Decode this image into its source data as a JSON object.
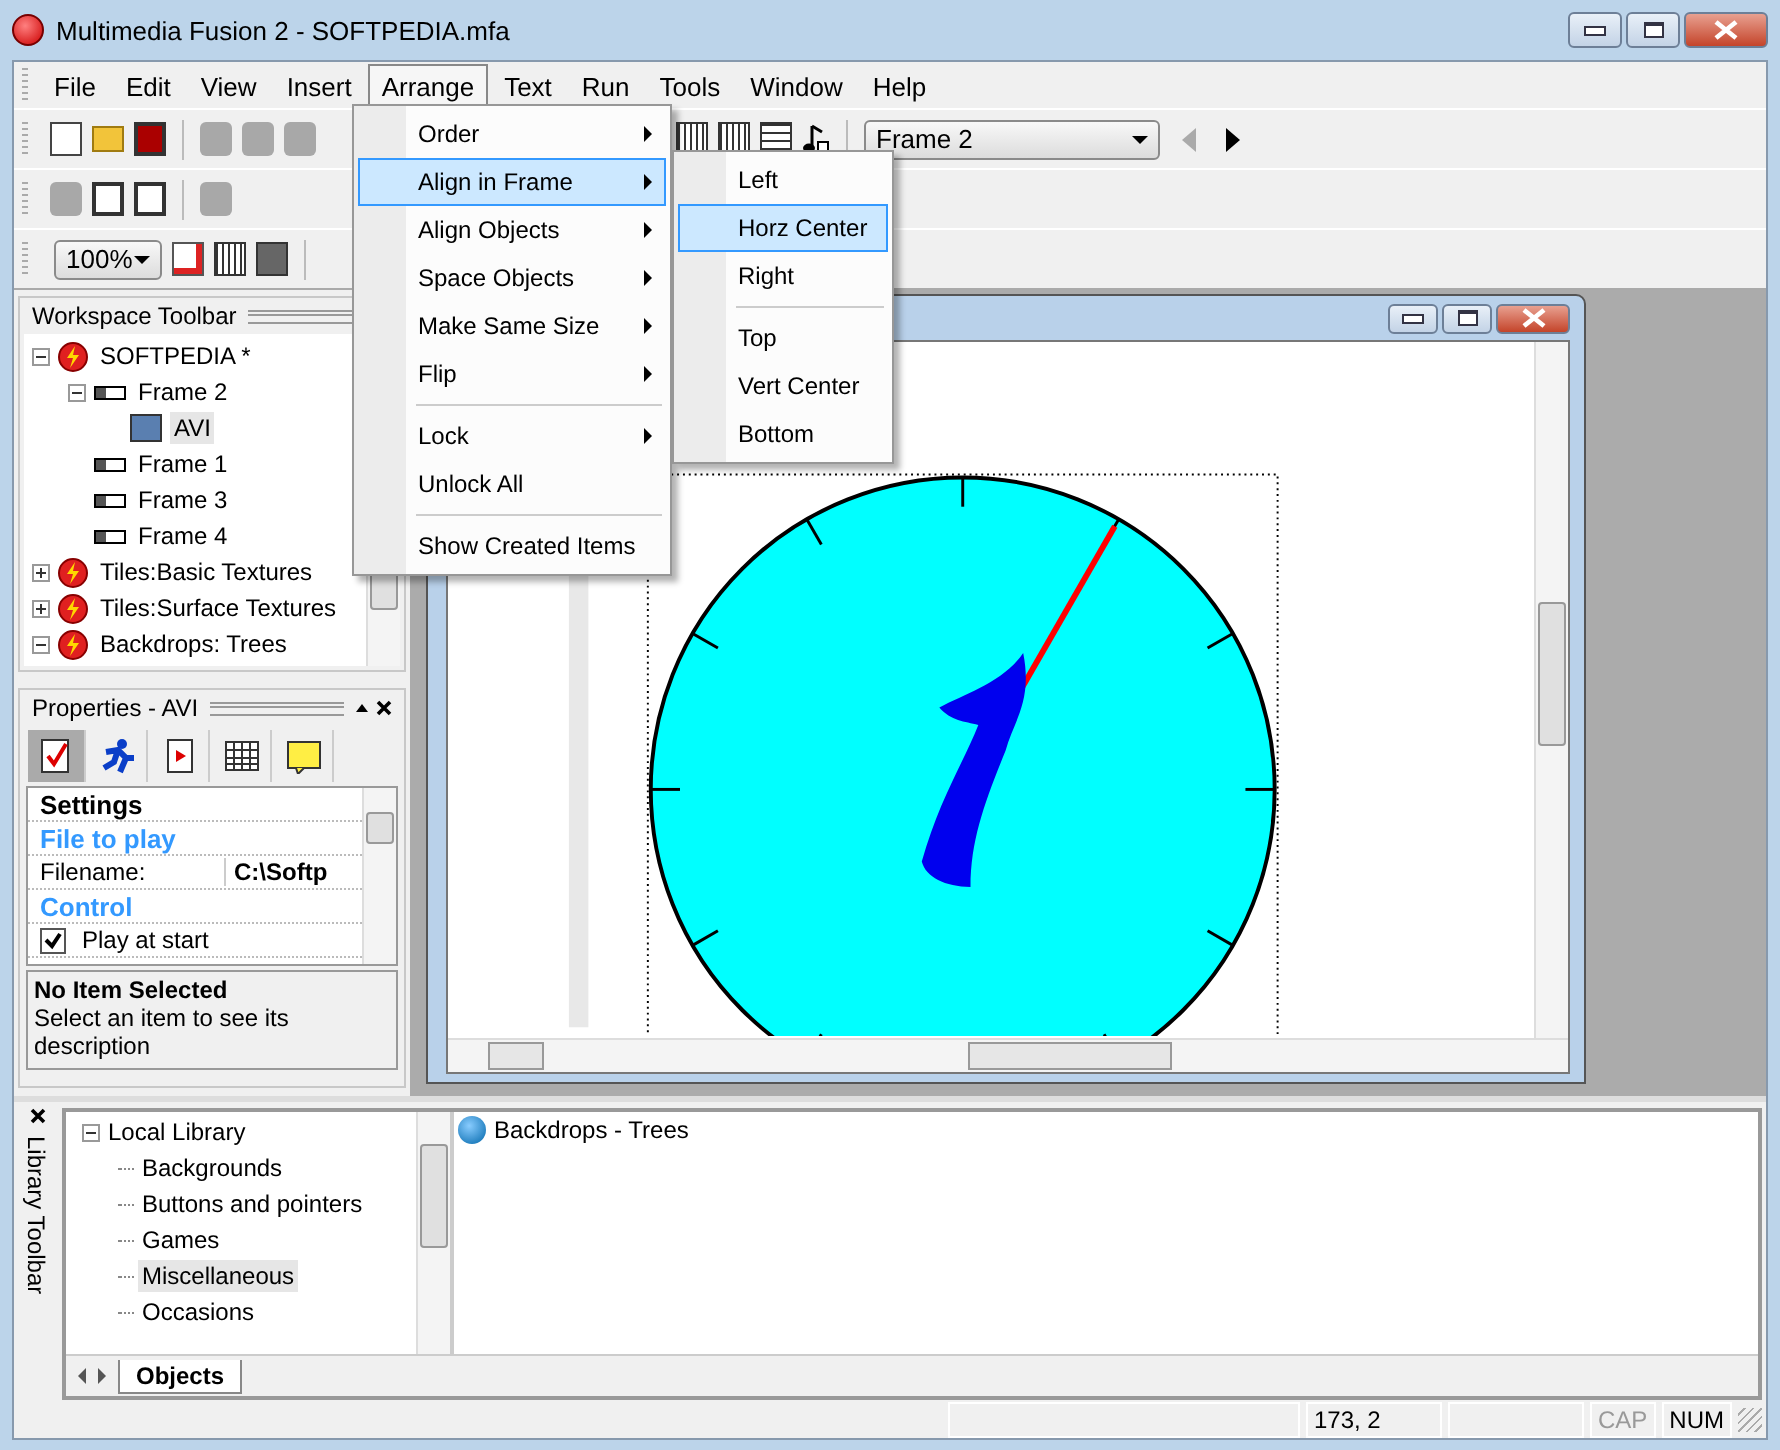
{
  "window": {
    "title": "Multimedia Fusion 2 - SOFTPEDIA.mfa"
  },
  "menu_bar": [
    {
      "label": "File",
      "selected": false
    },
    {
      "label": "Edit",
      "selected": false
    },
    {
      "label": "View",
      "selected": false
    },
    {
      "label": "Insert",
      "selected": false
    },
    {
      "label": "Arrange",
      "selected": true
    },
    {
      "label": "Text",
      "selected": false
    },
    {
      "label": "Run",
      "selected": false
    },
    {
      "label": "Tools",
      "selected": false
    },
    {
      "label": "Window",
      "selected": false
    },
    {
      "label": "Help",
      "selected": false
    }
  ],
  "frame_selector": {
    "value": "Frame 2"
  },
  "zoom_selector": {
    "value": "100%"
  },
  "workspace": {
    "title": "Workspace Toolbar",
    "tree": [
      {
        "label": "SOFTPEDIA *",
        "kind": "app",
        "expanded": true,
        "selected": false,
        "children": [
          {
            "label": "Frame 2",
            "kind": "frame",
            "expanded": true,
            "selected": false,
            "children": [
              {
                "label": "AVI",
                "kind": "object",
                "selected": true
              }
            ]
          },
          {
            "label": "Frame 1",
            "kind": "frame",
            "selected": false
          },
          {
            "label": "Frame 3",
            "kind": "frame",
            "selected": false
          },
          {
            "label": "Frame 4",
            "kind": "frame",
            "selected": false
          }
        ]
      },
      {
        "label": "Tiles:Basic Textures",
        "kind": "app",
        "expanded": false,
        "selected": false
      },
      {
        "label": "Tiles:Surface Textures",
        "kind": "app",
        "expanded": false,
        "selected": false
      },
      {
        "label": "Backdrops: Trees",
        "kind": "app",
        "expanded": true,
        "selected": false
      }
    ]
  },
  "properties": {
    "title": "Properties - AVI",
    "rows": [
      {
        "kind": "section",
        "label": "Settings"
      },
      {
        "kind": "group",
        "label": "File to play"
      },
      {
        "kind": "field",
        "label": "Filename:",
        "value": "C:\\Softp"
      },
      {
        "kind": "group",
        "label": "Control"
      },
      {
        "kind": "checkbox",
        "label": "Play at start",
        "checked": true
      }
    ],
    "description": {
      "title": "No Item Selected",
      "text": "Select an item to see its description"
    }
  },
  "arrange_menu": [
    {
      "kind": "item",
      "label": "Order",
      "submenu": true,
      "highlighted": false
    },
    {
      "kind": "item",
      "label": "Align in Frame",
      "submenu": true,
      "highlighted": true
    },
    {
      "kind": "item",
      "label": "Align Objects",
      "submenu": true,
      "highlighted": false
    },
    {
      "kind": "item",
      "label": "Space Objects",
      "submenu": true,
      "highlighted": false
    },
    {
      "kind": "item",
      "label": "Make Same Size",
      "submenu": true,
      "highlighted": false
    },
    {
      "kind": "item",
      "label": "Flip",
      "submenu": true,
      "highlighted": false
    },
    {
      "kind": "separator"
    },
    {
      "kind": "item",
      "label": "Lock",
      "submenu": true,
      "highlighted": false
    },
    {
      "kind": "item",
      "label": "Unlock All",
      "submenu": false,
      "highlighted": false
    },
    {
      "kind": "separator"
    },
    {
      "kind": "item",
      "label": "Show Created Items",
      "submenu": false,
      "highlighted": false
    }
  ],
  "align_submenu": [
    {
      "kind": "item",
      "label": "Left",
      "highlighted": false
    },
    {
      "kind": "item",
      "label": "Horz Center",
      "highlighted": true
    },
    {
      "kind": "item",
      "label": "Right",
      "highlighted": false
    },
    {
      "kind": "separator"
    },
    {
      "kind": "item",
      "label": "Top",
      "highlighted": false
    },
    {
      "kind": "item",
      "label": "Vert Center",
      "highlighted": false
    },
    {
      "kind": "item",
      "label": "Bottom",
      "highlighted": false
    }
  ],
  "library": {
    "side_label": "Library Toolbar",
    "tree": [
      {
        "label": "Local Library",
        "expanded": true,
        "selected": false,
        "children": [
          {
            "label": "Backgrounds",
            "selected": false
          },
          {
            "label": "Buttons and pointers",
            "selected": false
          },
          {
            "label": "Games",
            "selected": false
          },
          {
            "label": "Miscellaneous",
            "selected": true
          },
          {
            "label": "Occasions",
            "selected": false
          }
        ]
      }
    ],
    "tabs": [
      {
        "label": "Objects",
        "selected": true
      }
    ],
    "items": [
      {
        "label": "Backdrops - Trees"
      }
    ]
  },
  "status_bar": [
    {
      "text": "173, 2",
      "disabled": false
    },
    {
      "text": "CAP",
      "disabled": true
    },
    {
      "text": "NUM",
      "disabled": false
    }
  ]
}
